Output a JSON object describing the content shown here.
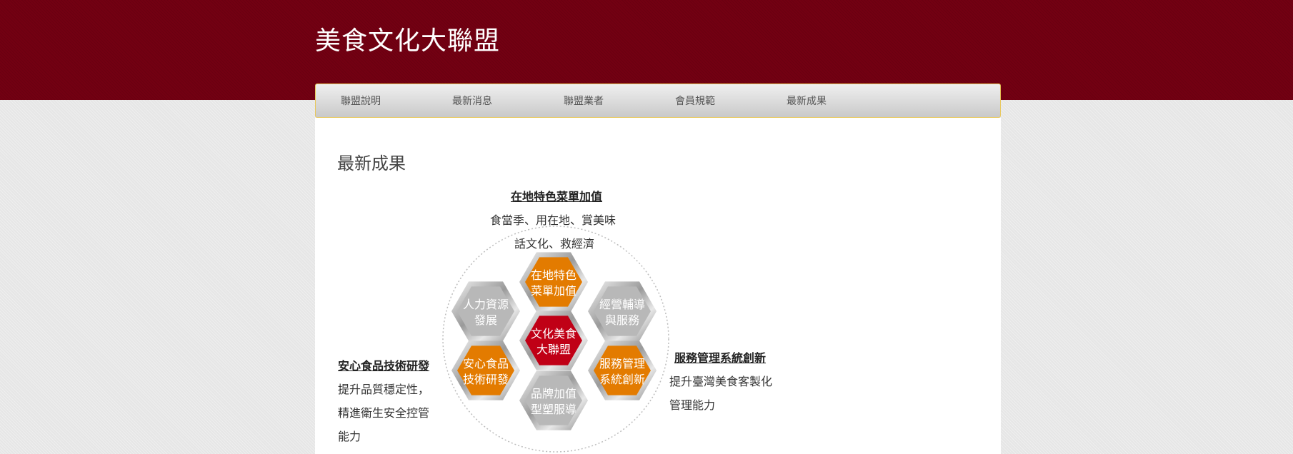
{
  "site": {
    "title": "美食文化大聯盟"
  },
  "nav": {
    "items": [
      "聯盟說明",
      "最新消息",
      "聯盟業者",
      "會員規範",
      "最新成果"
    ]
  },
  "page": {
    "title": "最新成果"
  },
  "annotations": {
    "top": {
      "heading": "在地特色菜單加值",
      "line1": "食當季、用在地、賞美味",
      "line2": "話文化、救經濟"
    },
    "left": {
      "heading": "安心食品技術研發",
      "line1": "提升品質穩定性，",
      "line2": "精進衛生安全控管",
      "line3": "能力"
    },
    "right": {
      "heading": "服務管理系統創新",
      "line1": "提升臺灣美食客製化",
      "line2": "管理能力"
    }
  },
  "hexes": [
    {
      "line1": "在地特色",
      "line2": "菜單加值",
      "color": "orange"
    },
    {
      "line1": "人力資源",
      "line2": "發展",
      "color": "gray"
    },
    {
      "line1": "經營輔導",
      "line2": "與服務",
      "color": "gray"
    },
    {
      "line1": "文化美食",
      "line2": "大聯盟",
      "color": "red"
    },
    {
      "line1": "安心食品",
      "line2": "技術研發",
      "color": "orange"
    },
    {
      "line1": "服務管理",
      "line2": "系統創新",
      "color": "orange"
    },
    {
      "line1": "品牌加值",
      "line2": "型塑服導",
      "color": "gray"
    }
  ],
  "colors": {
    "header": "#730012",
    "orange": "#e37b00",
    "gray": "#b8b8b8",
    "red": "#c00016"
  }
}
